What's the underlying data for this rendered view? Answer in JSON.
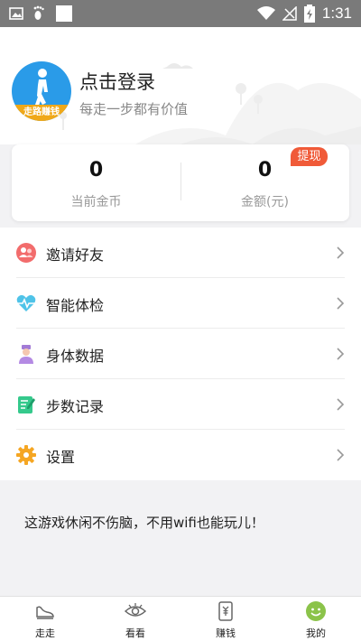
{
  "status_bar": {
    "time": "1:31",
    "left_icons": [
      "image-icon",
      "footprint-icon",
      "square-icon"
    ],
    "right_icons": [
      "wifi-icon",
      "no-signal-icon",
      "battery-charging-icon"
    ]
  },
  "profile": {
    "avatar_badge": "走路赚钱",
    "title": "点击登录",
    "subtitle": "每走一步都有价值"
  },
  "stats": {
    "coins_value": "0",
    "coins_label": "当前金币",
    "amount_value": "0",
    "amount_label": "金额(元)",
    "withdraw_label": "提现"
  },
  "menu": {
    "items": [
      {
        "label": "邀请好友",
        "icon": "invite-friends-icon"
      },
      {
        "label": "智能体检",
        "icon": "heart-pulse-icon"
      },
      {
        "label": "身体数据",
        "icon": "nurse-icon"
      },
      {
        "label": "步数记录",
        "icon": "notebook-icon"
      },
      {
        "label": "设置",
        "icon": "gear-icon"
      }
    ]
  },
  "promo_text": "这游戏休闲不伤脑，不用wifi也能玩儿！",
  "tabs": [
    {
      "label": "走走",
      "icon": "shoe-icon"
    },
    {
      "label": "看看",
      "icon": "eye-icon"
    },
    {
      "label": "赚钱",
      "icon": "money-icon"
    },
    {
      "label": "我的",
      "icon": "smiley-icon"
    }
  ],
  "colors": {
    "avatar_blue": "#2a9be8",
    "withdraw_red": "#f05a38",
    "active_tab_green": "#8bc34a"
  }
}
